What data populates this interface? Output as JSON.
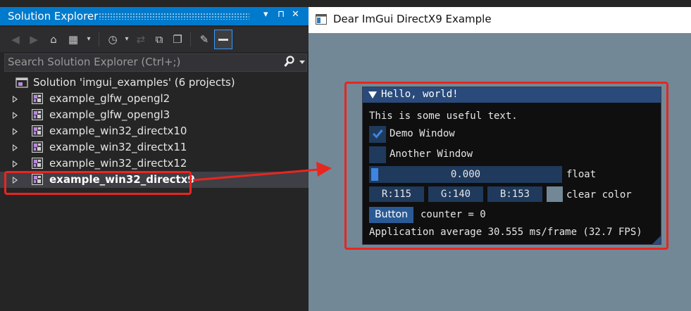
{
  "solution_explorer": {
    "title": "Solution Explorer",
    "title_buttons": [
      "▾",
      "⊓",
      "✕"
    ],
    "search_placeholder": "Search Solution Explorer (Ctrl+;)",
    "solution_label": "Solution 'imgui_examples' (6 projects)",
    "projects": [
      {
        "label": "example_glfw_opengl2",
        "selected": false
      },
      {
        "label": "example_glfw_opengl3",
        "selected": false
      },
      {
        "label": "example_win32_directx10",
        "selected": false
      },
      {
        "label": "example_win32_directx11",
        "selected": false
      },
      {
        "label": "example_win32_directx12",
        "selected": false
      },
      {
        "label": "example_win32_directx9",
        "selected": true
      }
    ]
  },
  "app_window": {
    "title": "Dear ImGui DirectX9 Example",
    "imgui": {
      "window_title": "Hello, world!",
      "text": "This is some useful text.",
      "checkboxes": [
        {
          "label": "Demo Window",
          "checked": true
        },
        {
          "label": "Another Window",
          "checked": false
        }
      ],
      "slider": {
        "value_text": "0.000",
        "label": "float",
        "fraction": 0.0
      },
      "color": {
        "r": "R:115",
        "g": "G:140",
        "b": "B:153",
        "label": "clear color",
        "hex": "#738c99"
      },
      "button": {
        "label": "Button",
        "counter_text": "counter = 0"
      },
      "fps_text": "Application average 30.555 ms/frame (32.7 FPS)"
    }
  },
  "colors": {
    "accent": "#007acc",
    "annotation": "#e8261f",
    "imgui_header": "#294a7a",
    "imgui_frame": "#1f3a5d",
    "clear_color": "#728896"
  }
}
